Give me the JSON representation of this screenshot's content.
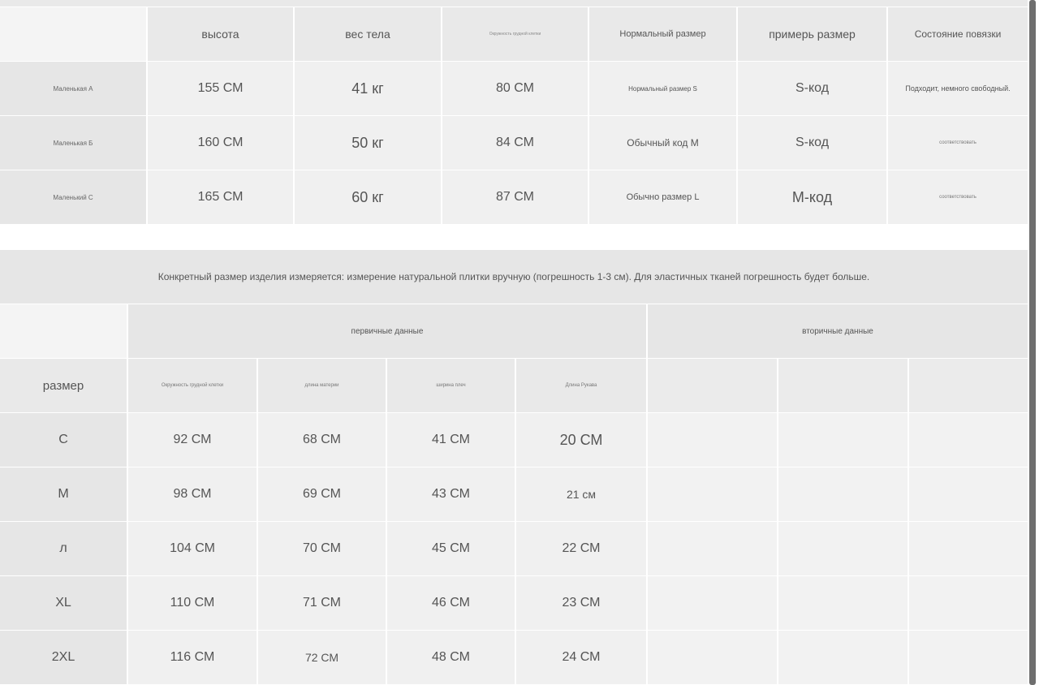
{
  "table1": {
    "headers": [
      "",
      "высота",
      "вес тела",
      "Окружность грудной клетки",
      "Нормальный размер",
      "примерь размер",
      "Состояние повязки"
    ],
    "rows": [
      [
        "Маленькая А",
        "155 СМ",
        "41 кг",
        "80 СМ",
        "Нормальный размер S",
        "S-код",
        "Подходит, немного свободный."
      ],
      [
        "Маленькая Б",
        "160 СМ",
        "50 кг",
        "84 СМ",
        "Обычный код М",
        "S-код",
        "соответствовать"
      ],
      [
        "Маленький С",
        "165 СМ",
        "60 кг",
        "87 СМ",
        "Обычно размер L",
        "M-код",
        "соответствовать"
      ]
    ]
  },
  "note": "Конкретный размер изделия измеряется: измерение натуральной плитки вручную (погрешность 1-3 см). Для эластичных тканей погрешность будет больше.",
  "table2": {
    "group_primary": "первичные данные",
    "group_secondary": "вторичные данные",
    "headers": [
      "размер",
      "Окружность грудной клетки",
      "длина материи",
      "ширина плеч",
      "Длина Рукава"
    ],
    "rows": [
      [
        "C",
        "92 СМ",
        "68 СМ",
        "41 СМ",
        "20 СМ"
      ],
      [
        "M",
        "98 СМ",
        "69 СМ",
        "43 СМ",
        "21 см"
      ],
      [
        "л",
        "104 СМ",
        "70 СМ",
        "45 СМ",
        "22 СМ"
      ],
      [
        "XL",
        "110 СМ",
        "71 СМ",
        "46 СМ",
        "23 СМ"
      ],
      [
        "2XL",
        "116 СМ",
        "72 СМ",
        "48 СМ",
        "24 СМ"
      ]
    ]
  }
}
